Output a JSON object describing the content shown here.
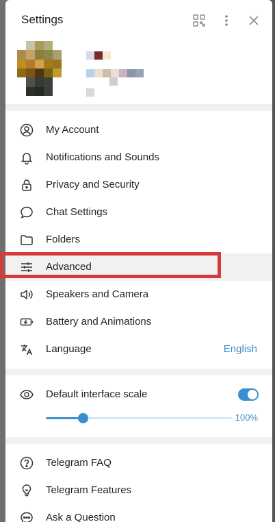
{
  "header": {
    "title": "Settings",
    "icons": [
      "qr-code-icon",
      "more-vertical-icon",
      "close-icon"
    ]
  },
  "menu": [
    {
      "label": "My Account",
      "icon": "user-circle-icon"
    },
    {
      "label": "Notifications and Sounds",
      "icon": "bell-icon"
    },
    {
      "label": "Privacy and Security",
      "icon": "lock-icon"
    },
    {
      "label": "Chat Settings",
      "icon": "chat-bubble-icon"
    },
    {
      "label": "Folders",
      "icon": "folder-icon"
    },
    {
      "label": "Advanced",
      "icon": "sliders-icon",
      "highlighted": true
    },
    {
      "label": "Speakers and Camera",
      "icon": "speaker-icon"
    },
    {
      "label": "Battery and Animations",
      "icon": "battery-icon"
    },
    {
      "label": "Language",
      "icon": "translate-icon",
      "value": "English"
    }
  ],
  "scale": {
    "label": "Default interface scale",
    "icon": "eye-icon",
    "toggle_on": true,
    "slider_fraction": 0.2,
    "value": "100%"
  },
  "help": [
    {
      "label": "Telegram FAQ",
      "icon": "question-circle-icon"
    },
    {
      "label": "Telegram Features",
      "icon": "lightbulb-icon"
    },
    {
      "label": "Ask a Question",
      "icon": "chat-dots-icon"
    }
  ],
  "colors": {
    "accent": "#3a8fd0",
    "highlight_box": "#d53b3b",
    "separator": "#f1f1f1"
  }
}
